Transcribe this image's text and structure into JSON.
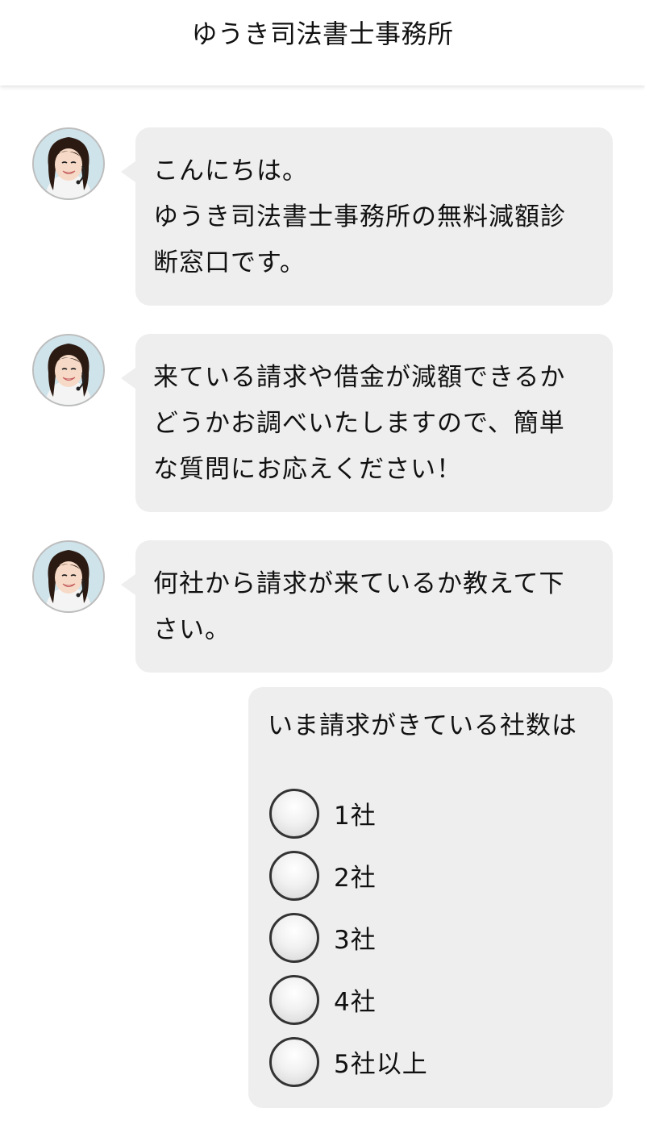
{
  "header": {
    "title": "ゆうき司法書士事務所"
  },
  "messages": [
    {
      "avatar": "operator-avatar",
      "lines": [
        "こんにちは。",
        "ゆうき司法書士事務所の無料減額診",
        "断窓口です。"
      ]
    },
    {
      "avatar": "operator-avatar",
      "lines": [
        "来ている請求や借金が減額できるか",
        "どうかお調べいたしますので、簡単",
        "な質問にお応えください！"
      ]
    },
    {
      "avatar": "operator-avatar",
      "lines": [
        "何社から請求が来ているか教えて下",
        "さい。"
      ]
    }
  ],
  "question": {
    "label": "いま請求がきている社数は",
    "options": [
      "1社",
      "2社",
      "3社",
      "4社",
      "5社以上"
    ],
    "selected": null
  },
  "colors": {
    "bubble_bg": "#eeeeee",
    "header_bg": "#ffffff",
    "text": "#111111"
  }
}
